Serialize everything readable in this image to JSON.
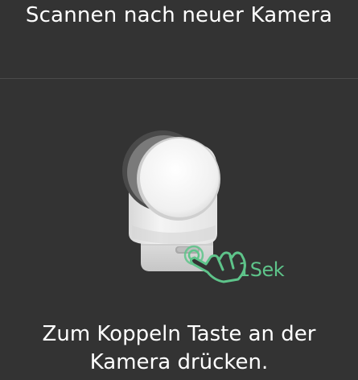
{
  "header": {
    "title": "Scannen nach neuer Kamera"
  },
  "illustration": {
    "hold_duration_label": "1Sek",
    "accent_color": "#5ec48a"
  },
  "instruction": {
    "text": "Zum Koppeln Taste an der Kamera drücken."
  }
}
